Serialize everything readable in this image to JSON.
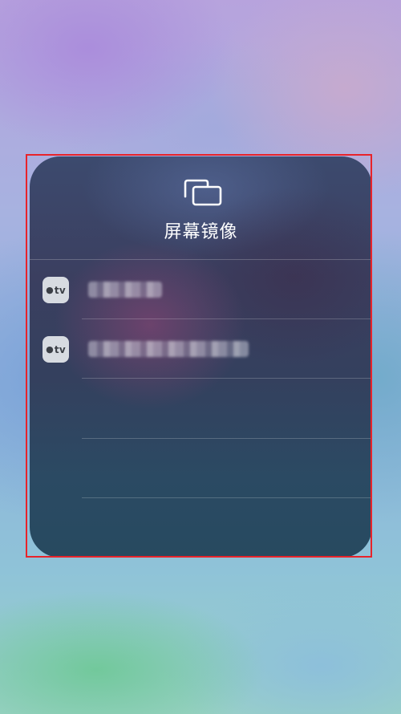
{
  "screen_mirroring": {
    "title": "屏幕镜像",
    "icon": "screen-mirroring-icon",
    "devices": [
      {
        "badge": "tv",
        "badge_icon": "apple-logo-icon",
        "name_redacted": true
      },
      {
        "badge": "tv",
        "badge_icon": "apple-logo-icon",
        "name_redacted": true
      }
    ]
  },
  "colors": {
    "highlight_border": "#e8232a",
    "title_text": "#ffffff",
    "badge_background": "#d7dbe1"
  }
}
